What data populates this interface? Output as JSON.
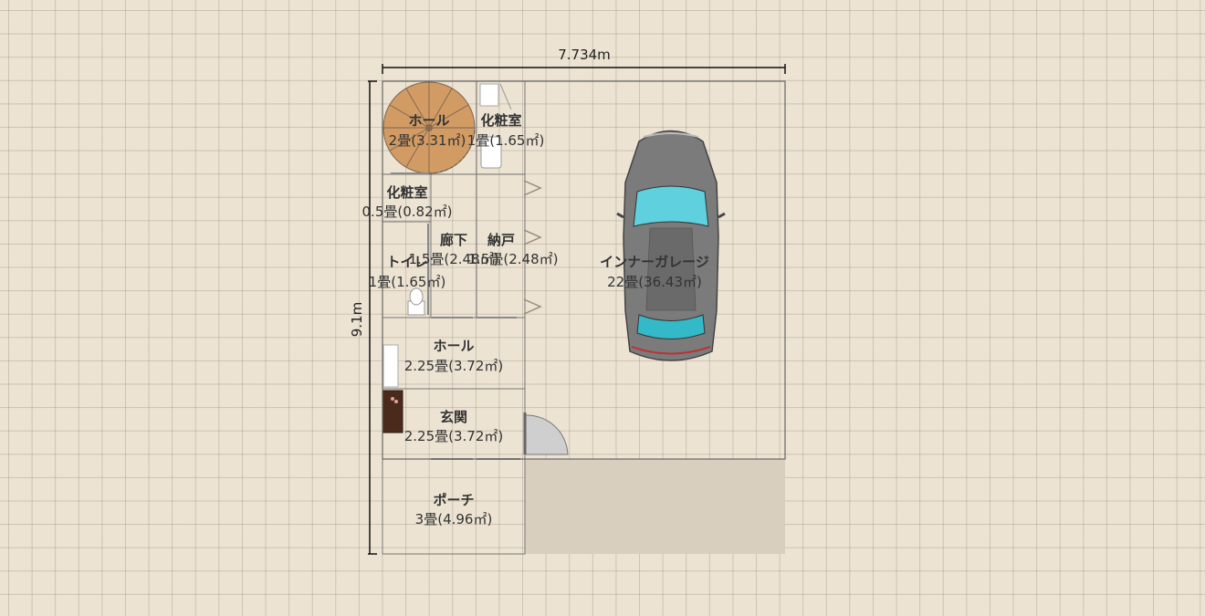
{
  "dimensions": {
    "width": "7.734m",
    "height": "9.1m"
  },
  "rooms": [
    {
      "name": "ホール",
      "area": "2畳(3.31㎡)"
    },
    {
      "name": "化粧室",
      "area": "1畳(1.65㎡)"
    },
    {
      "name": "化粧室",
      "area": "0.5畳(0.82㎡)"
    },
    {
      "name": "廊下",
      "area": "1.5畳(2.48㎡)"
    },
    {
      "name": "納戸",
      "area": "1.5畳(2.48㎡)"
    },
    {
      "name": "トイレ",
      "area": "1畳(1.65㎡)"
    },
    {
      "name": "ホール",
      "area": "2.25畳(3.72㎡)"
    },
    {
      "name": "玄関",
      "area": "2.25畳(3.72㎡)"
    },
    {
      "name": "ポーチ",
      "area": "3畳(4.96㎡)"
    },
    {
      "name": "インナーガレージ",
      "area": "22畳(36.43㎡)"
    }
  ],
  "colors": {
    "wood_floor": "#dcaa72",
    "garage_floor": "#e4e4e4",
    "tile_floor": "#f2ecdf",
    "car_glass": "#5ed0de",
    "car_body": "#7a7a7a"
  }
}
